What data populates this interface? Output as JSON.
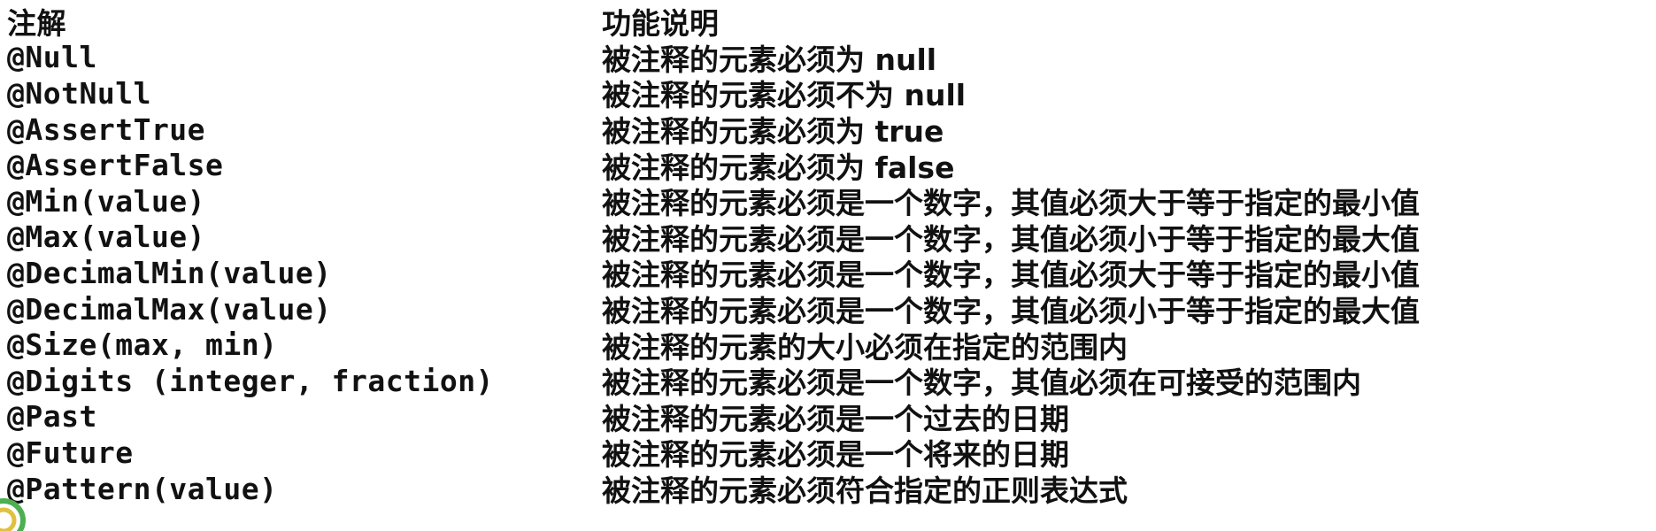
{
  "table": {
    "header": {
      "annotation": "注解",
      "description": "功能说明"
    },
    "rows": [
      {
        "annotation": "@Null",
        "description": "被注释的元素必须为 null"
      },
      {
        "annotation": "@NotNull",
        "description": "被注释的元素必须不为 null"
      },
      {
        "annotation": "@AssertTrue",
        "description": "被注释的元素必须为 true"
      },
      {
        "annotation": "@AssertFalse",
        "description": "被注释的元素必须为 false"
      },
      {
        "annotation": "@Min(value)",
        "description": "被注释的元素必须是一个数字，其值必须大于等于指定的最小值"
      },
      {
        "annotation": "@Max(value)",
        "description": "被注释的元素必须是一个数字，其值必须小于等于指定的最大值"
      },
      {
        "annotation": "@DecimalMin(value)",
        "description": "被注释的元素必须是一个数字，其值必须大于等于指定的最小值"
      },
      {
        "annotation": "@DecimalMax(value)",
        "description": "被注释的元素必须是一个数字，其值必须小于等于指定的最大值"
      },
      {
        "annotation": "@Size(max, min)",
        "description": "被注释的元素的大小必须在指定的范围内"
      },
      {
        "annotation": "@Digits (integer, fraction)",
        "description": "被注释的元素必须是一个数字，其值必须在可接受的范围内"
      },
      {
        "annotation": "@Past",
        "description": "被注释的元素必须是一个过去的日期"
      },
      {
        "annotation": "@Future",
        "description": "被注释的元素必须是一个将来的日期"
      },
      {
        "annotation": "@Pattern(value)",
        "description": "被注释的元素必须符合指定的正则表达式"
      }
    ]
  },
  "colors": {
    "text": "#111111",
    "background": "#ffffff",
    "decor_green": "#4caf50",
    "decor_yellow": "#e0c040"
  }
}
